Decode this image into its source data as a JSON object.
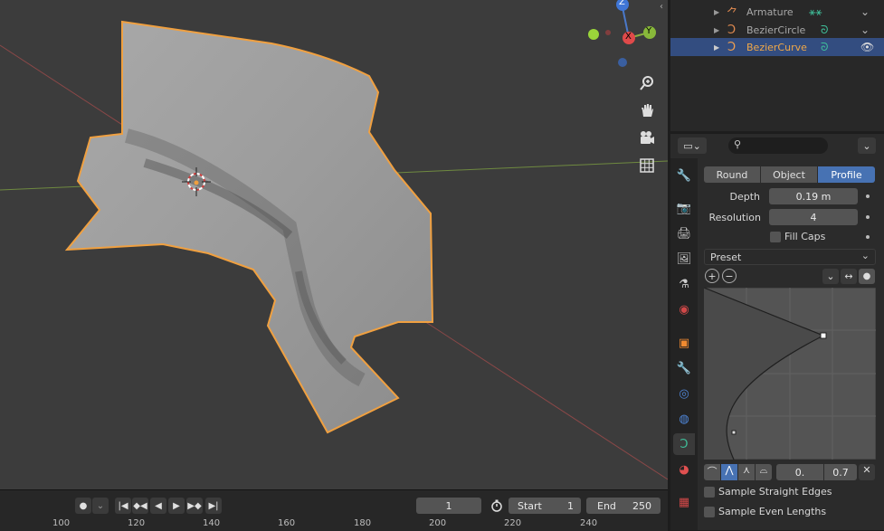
{
  "outliner": {
    "items": [
      {
        "label": "Armature",
        "color": "#b2b2b2",
        "selected": false
      },
      {
        "label": "BezierCircle",
        "color": "#b2b2b2",
        "selected": false
      },
      {
        "label": "BezierCurve",
        "color": "#e8a040",
        "selected": true
      }
    ]
  },
  "gizmo": {
    "z": "Z",
    "x": "X",
    "y": "Y"
  },
  "properties": {
    "search_placeholder": "",
    "bevel_modes": [
      "Round",
      "Object",
      "Profile"
    ],
    "active_mode": "Profile",
    "depth_label": "Depth",
    "depth_value": "0.19 m",
    "resolution_label": "Resolution",
    "resolution_value": "4",
    "fill_caps_label": "Fill Caps",
    "preset_label": "Preset",
    "curve_x_value": "0.",
    "curve_y_value": "0.7",
    "sample_straight_label": "Sample Straight Edges",
    "sample_even_label": "Sample Even Lengths"
  },
  "timeline": {
    "current_frame": "1",
    "start_label": "Start",
    "start_value": "1",
    "end_label": "End",
    "end_value": "250",
    "ruler": [
      "100",
      "120",
      "140",
      "160",
      "180",
      "200",
      "220",
      "240"
    ]
  },
  "colors": {
    "accent": "#4772b3",
    "selection_outline": "#f0a040",
    "viewport_bg": "#3c3c3c"
  }
}
